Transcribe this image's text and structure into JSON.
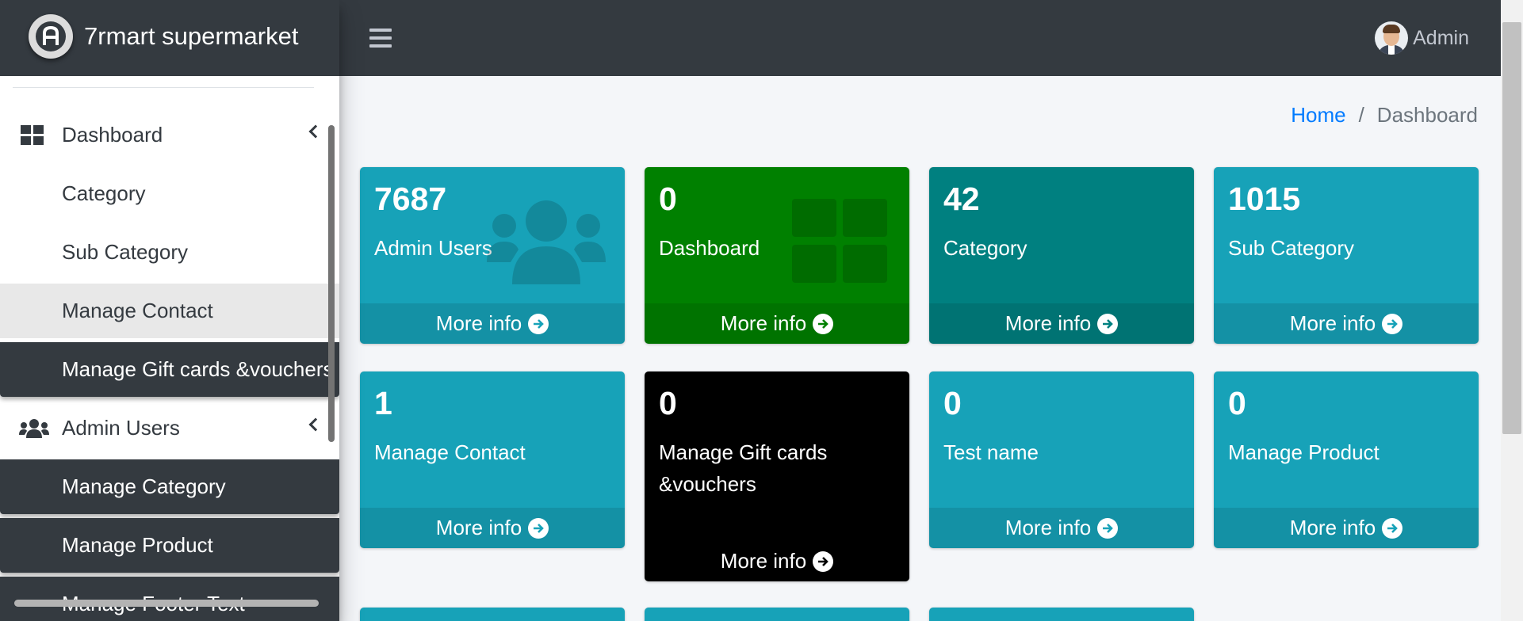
{
  "brand": {
    "name": "7rmart supermarket",
    "logo_letter": "A"
  },
  "navbar": {
    "user_name": "Admin"
  },
  "breadcrumb": {
    "home": "Home",
    "separator": "/",
    "current": "Dashboard"
  },
  "sidebar": {
    "items": [
      {
        "label": "Dashboard",
        "icon": "th-large-icon"
      },
      {
        "label": "Category"
      },
      {
        "label": "Sub Category"
      },
      {
        "label": "Manage Contact"
      },
      {
        "label": "Manage Gift cards &vouchers"
      },
      {
        "label": "Admin Users",
        "icon": "users-icon"
      },
      {
        "label": "Manage Category"
      },
      {
        "label": "Manage Product"
      },
      {
        "label": "Manage Footer Text"
      }
    ]
  },
  "boxes": [
    {
      "count": "7687",
      "label": "Admin Users",
      "link": "More info",
      "color": "#17a2b8",
      "icon": "users-icon"
    },
    {
      "count": "0",
      "label": "Dashboard",
      "link": "More info",
      "color": "#008000",
      "icon": "th-large-icon"
    },
    {
      "count": "42",
      "label": "Category",
      "link": "More info",
      "color": "#008080"
    },
    {
      "count": "1015",
      "label": "Sub Category",
      "link": "More info",
      "color": "#17a2b8"
    },
    {
      "count": "1",
      "label": "Manage Contact",
      "link": "More info",
      "color": "#17a2b8"
    },
    {
      "count": "0",
      "label": "Manage Gift cards &vouchers",
      "link": "More info",
      "color": "#000000"
    },
    {
      "count": "0",
      "label": "Test name",
      "link": "More info",
      "color": "#17a2b8"
    },
    {
      "count": "0",
      "label": "Manage Product",
      "link": "More info",
      "color": "#17a2b8"
    }
  ],
  "colors": {
    "navbar_bg": "#343a40",
    "link": "#007bff",
    "info": "#17a2b8",
    "green": "#008000",
    "teal": "#008080",
    "black": "#000000"
  }
}
